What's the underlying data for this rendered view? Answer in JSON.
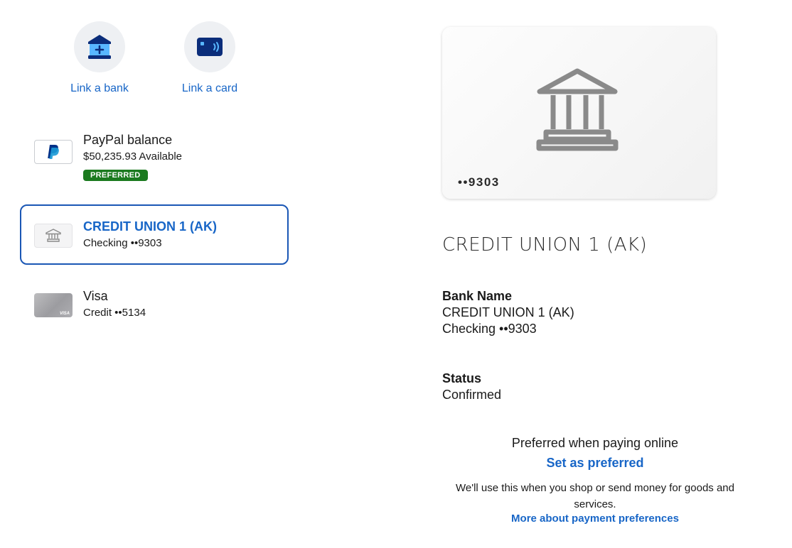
{
  "quick_actions": {
    "link_bank": "Link a bank",
    "link_card": "Link a card"
  },
  "wallet": {
    "paypal": {
      "title": "PayPal balance",
      "subtitle": "$50,235.93 Available",
      "badge": "PREFERRED"
    },
    "bank": {
      "title": "CREDIT UNION 1 (AK)",
      "subtitle": "Checking ••9303"
    },
    "visa": {
      "title": "Visa",
      "subtitle": "Credit ••5134"
    }
  },
  "detail": {
    "card_number": "••9303",
    "heading": "CREDIT UNION 1 (AK)",
    "bank_name_label": "Bank Name",
    "bank_name_value": "CREDIT UNION 1 (AK)",
    "account_value": "Checking ••9303",
    "status_label": "Status",
    "status_value": "Confirmed",
    "preferred_text": "Preferred when paying online",
    "set_preferred": "Set as preferred",
    "info_text": "We'll use this when you shop or send money for goods and services.",
    "more_link": "More about payment preferences"
  },
  "colors": {
    "link": "#1866c7",
    "selected_border": "#1a57b5",
    "preferred_badge": "#1b7a1f",
    "icon_navy": "#0b2d7a",
    "icon_light_blue": "#58b7ff"
  }
}
